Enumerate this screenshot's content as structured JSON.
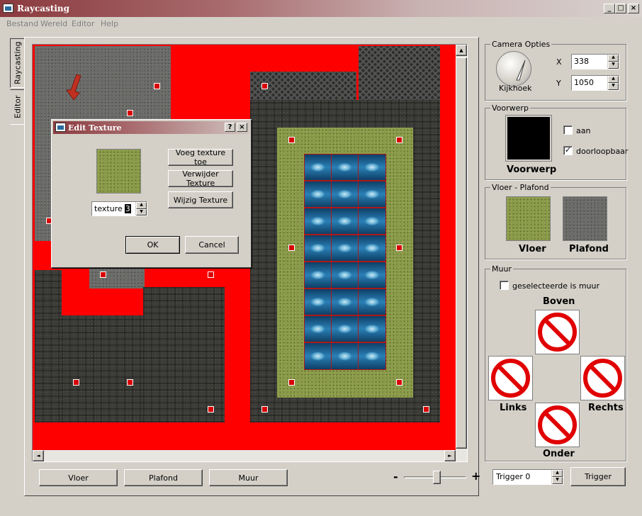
{
  "window": {
    "title": "Raycasting",
    "controls": {
      "minimize": "_",
      "maximize": "□",
      "close": "×"
    }
  },
  "menu": {
    "items": [
      "Bestand",
      "Wereld",
      "Editor",
      "Help"
    ]
  },
  "side_tabs": {
    "raycasting": "Raycasting",
    "editor": "Editor"
  },
  "camera": {
    "group_label": "Camera Opties",
    "dial_label": "Kijkhoek",
    "x_label": "X",
    "x_value": "338",
    "y_label": "Y",
    "y_value": "1050"
  },
  "object": {
    "group_label": "Voorwerp",
    "preview_label": "Voorwerp",
    "on_label": "aan",
    "on_checked": false,
    "passable_label": "doorloopbaar",
    "passable_checked": true,
    "check_mark": "✓"
  },
  "floor_ceiling": {
    "group_label": "Vloer - Plafond",
    "floor_label": "Vloer",
    "ceiling_label": "Plafond"
  },
  "wall": {
    "group_label": "Muur",
    "selected_is_wall_label": "geselecteerde is muur",
    "top_label": "Boven",
    "left_label": "Links",
    "right_label": "Rechts",
    "bottom_label": "Onder"
  },
  "bottom_bar": {
    "floor_button": "Vloer",
    "ceiling_button": "Plafond",
    "wall_button": "Muur",
    "zoom_minus": "-",
    "zoom_plus": "+",
    "trigger_value": "Trigger 0",
    "trigger_button": "Trigger"
  },
  "dialog": {
    "title": "Edit Texture",
    "help": "?",
    "close": "×",
    "add_button": "Voeg texture toe",
    "remove_button": "Verwijder Texture",
    "change_button": "Wijzig Texture",
    "texture_label": "texture",
    "texture_value": "3",
    "ok_button": "OK",
    "cancel_button": "Cancel"
  },
  "scroll": {
    "up": "▲",
    "down": "▼",
    "left": "◄",
    "right": "►"
  },
  "colors": {
    "wall_red": "#ff0000",
    "marker_red": "#d80000"
  }
}
